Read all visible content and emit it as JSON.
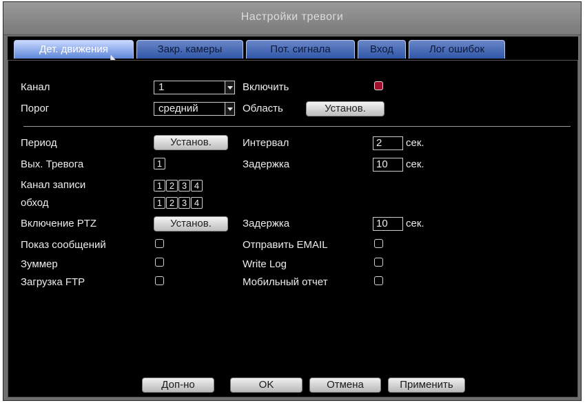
{
  "window": {
    "title": "Настройки тревоги"
  },
  "tabs": [
    {
      "label": "Дет. движения",
      "active": true
    },
    {
      "label": "Закр. камеры"
    },
    {
      "label": "Пот. сигнала"
    },
    {
      "label": "Вход"
    },
    {
      "label": "Лог ошибок"
    }
  ],
  "form": {
    "channel_label": "Канал",
    "channel_value": "1",
    "enable_label": "Включить",
    "enable_checked": true,
    "threshold_label": "Порог",
    "threshold_value": "средний",
    "area_label": "Область",
    "area_button": "Установ.",
    "period_label": "Период",
    "period_button": "Установ.",
    "interval_label": "Интервал",
    "interval_value": "2",
    "interval_unit": "сек.",
    "alarm_out_label": "Вых. Тревога",
    "alarm_out_box": "1",
    "delay_label": "Задержка",
    "delay_value": "10",
    "delay_unit": "сек.",
    "record_channel_label": "Канал записи",
    "tour_label": "обход",
    "channel_boxes": [
      "1",
      "2",
      "3",
      "4"
    ],
    "ptz_label": "Включение PTZ",
    "ptz_button": "Установ.",
    "delay2_label": "Задержка",
    "delay2_value": "10",
    "delay2_unit": "сек.",
    "show_message_label": "Показ сообщений",
    "send_email_label": "Отправить EMAIL",
    "buzzer_label": "Зуммер",
    "write_log_label": "Write Log",
    "ftp_upload_label": "Загрузка FTP",
    "mobile_report_label": "Мобильный отчет"
  },
  "footer": {
    "advanced": "Доп-но",
    "ok": "OK",
    "cancel": "Отмена",
    "apply": "Применить"
  },
  "colors": {
    "tab_active": "#c9d8ff",
    "tab_inactive": "#2f56a8",
    "checkbox_checked": "#a0102a",
    "panel_bg": "#000000"
  }
}
